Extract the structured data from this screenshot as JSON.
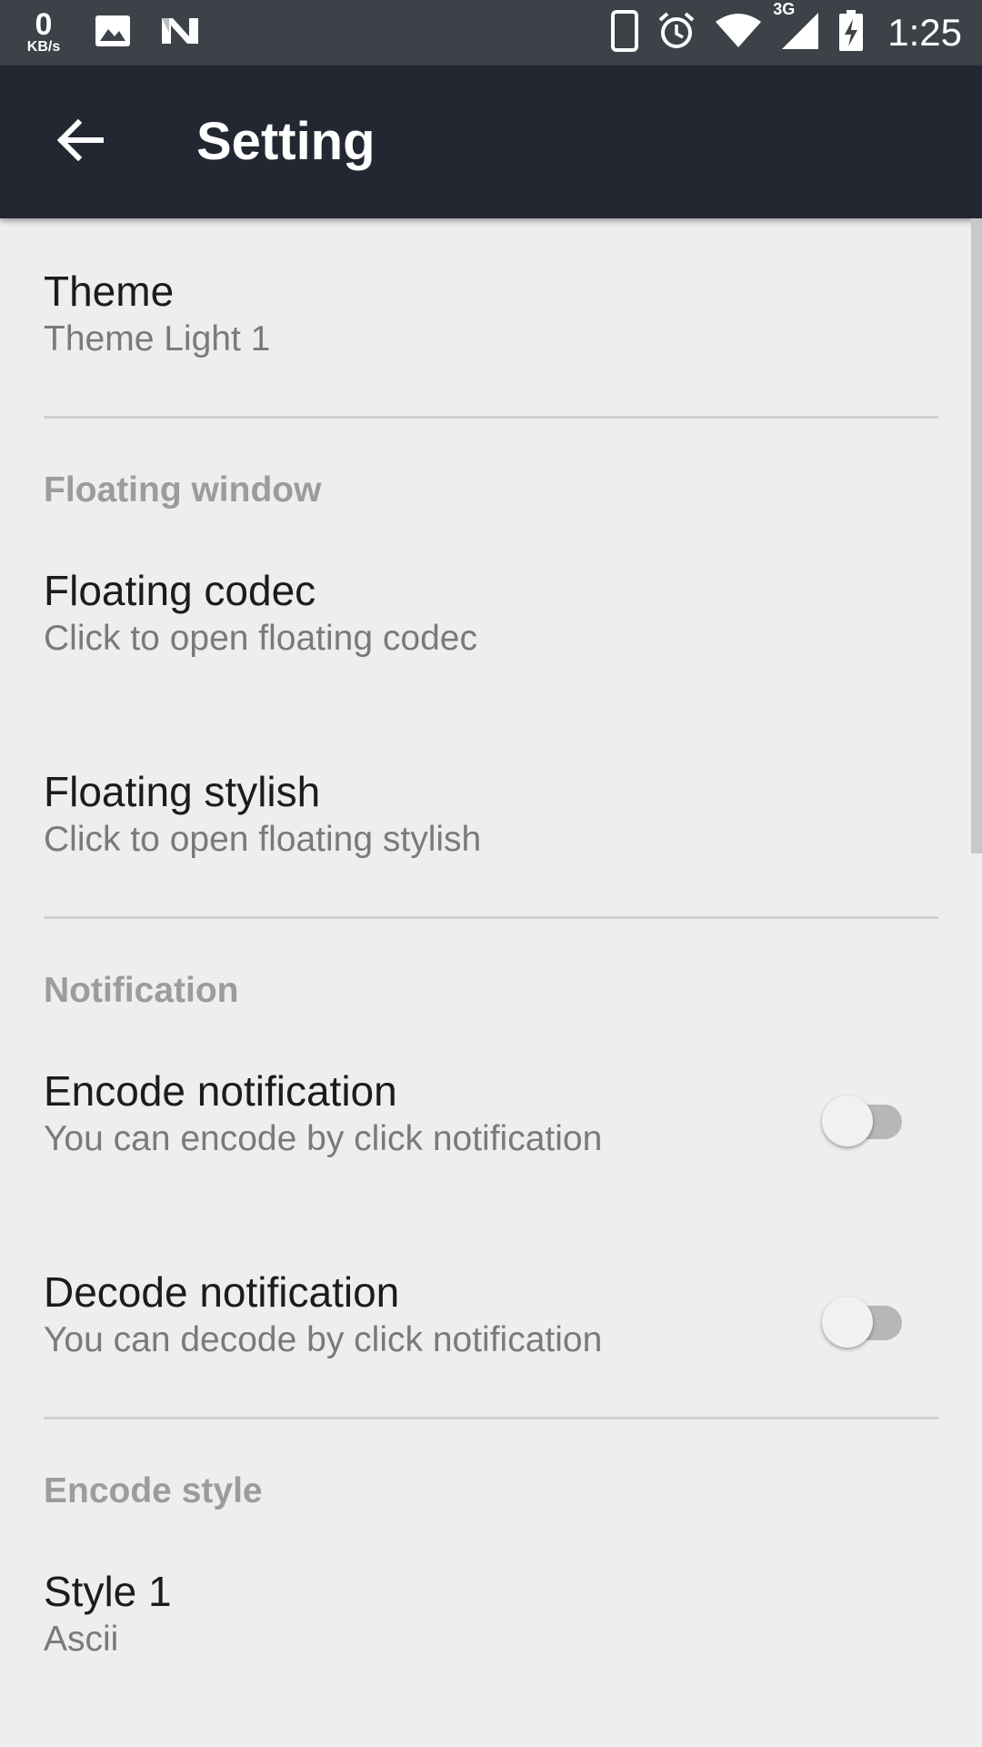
{
  "status_bar": {
    "speed_value": "0",
    "speed_unit": "KB/s",
    "network_type": "3G",
    "time": "1:25",
    "icons": [
      "image-icon",
      "app-n-icon",
      "phone-icon",
      "alarm-icon",
      "wifi-icon",
      "cell-signal-icon",
      "battery-charging-icon"
    ]
  },
  "app_bar": {
    "title": "Setting",
    "back_icon": "arrow-back-icon"
  },
  "settings": {
    "theme": {
      "title": "Theme",
      "summary": "Theme Light 1"
    },
    "floating_window": {
      "header": "Floating window",
      "codec": {
        "title": "Floating codec",
        "summary": "Click to open floating codec"
      },
      "stylish": {
        "title": "Floating stylish",
        "summary": "Click to open floating stylish"
      }
    },
    "notification": {
      "header": "Notification",
      "encode": {
        "title": "Encode notification",
        "summary": "You can encode by click notification",
        "enabled": false
      },
      "decode": {
        "title": "Decode notification",
        "summary": "You can decode by click notification",
        "enabled": false
      }
    },
    "encode_style": {
      "header": "Encode style",
      "style1": {
        "title": "Style 1",
        "summary": "Ascii"
      }
    }
  },
  "colors": {
    "status_bar": "#3d4148",
    "app_bar": "#222731",
    "background": "#eeeeee",
    "section_header": "#9c9c9c"
  }
}
